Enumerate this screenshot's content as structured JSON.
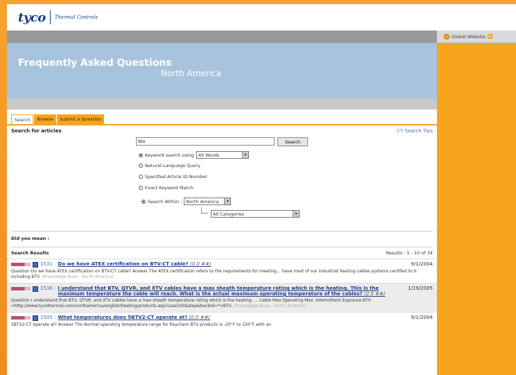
{
  "brand": {
    "logo": "tyco",
    "sub": "Thermal Controls"
  },
  "sidebar": {
    "global_label": "Global Website"
  },
  "hero": {
    "title": "Frequently Asked Questions",
    "region": "North America"
  },
  "tabs": [
    "Search",
    "Browse",
    "Submit a Question"
  ],
  "search": {
    "section_title": "Search for articles",
    "tips": "(?) Search Tips",
    "query": "btv",
    "button": "Search",
    "options": [
      "Keyword search using",
      "Natural Language Query",
      "Specified Article ID Number",
      "Exact Keyword Match"
    ],
    "keyword_mode": "All Words",
    "within_label": "Search Within :",
    "within_value": "North America",
    "category_value": "All Categories"
  },
  "did_you_mean": "Did you mean :",
  "results": {
    "title": "Search Results",
    "count": "Results : 1 - 10 of 34",
    "items": [
      {
        "id": "1531 :",
        "title": "Do we have ATEX certification on BTV-CT cable?",
        "score": "(0.0 ##)",
        "date": "9/1/2004",
        "body": "Question Do we have ATEX certification on BTV-CT cable? Answer  The ATEX certification refers to the requirements for meeting... have most of our industrial heating cables systems certified to it including BTV.",
        "source": "(Knowledge Base - North America)"
      },
      {
        "id": "1536 :",
        "title": "I understand that BTV, QTVR, and XTV cables have a max sheath temperature rating which is the heating. This is the maximum temperature the cable will reach. What is the actual maximum operating temperature of the cables?",
        "score": "(2.5 ##)",
        "date": "1/19/2005",
        "body": "Question I understand that BTV, QTVR, and XTV cables have a max sheath temperature rating which is the heating. ... Cable   Max Operating   Max. Intermittent Exposure BTV >http://www.tycothermal.com/northamerica/english/heating/products.asp?case100&step&backId=*>BTV,",
        "source": "(Knowledge Base - North America)"
      },
      {
        "id": "1505 :",
        "title": "What temperatures does 5BTV2-CT operate at?",
        "score": "(0.0 ##)",
        "date": "9/1/2004",
        "body": "5BTV2-CT operate at? Answer The Normal operating temperature range for Raychem BTV products is -20°F to 150°F with an",
        "source": ""
      }
    ]
  }
}
